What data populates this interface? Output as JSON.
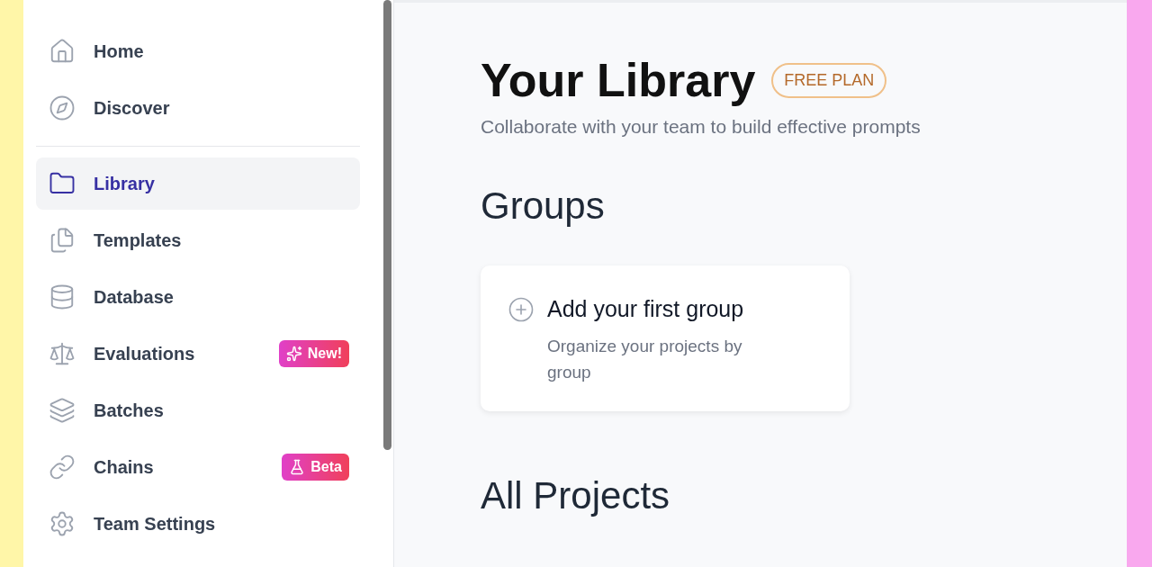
{
  "sidebar": {
    "sections": [
      [
        {
          "label": "Home",
          "selected": false
        },
        {
          "label": "Discover",
          "selected": false
        }
      ],
      [
        {
          "label": "Library",
          "selected": true
        },
        {
          "label": "Templates",
          "selected": false
        },
        {
          "label": "Database",
          "selected": false
        },
        {
          "label": "Evaluations",
          "selected": false,
          "badge": {
            "kind": "new",
            "text": "New!"
          }
        },
        {
          "label": "Batches",
          "selected": false
        },
        {
          "label": "Chains",
          "selected": false,
          "badge": {
            "kind": "beta",
            "text": "Beta"
          }
        },
        {
          "label": "Team Settings",
          "selected": false
        }
      ]
    ]
  },
  "header": {
    "title": "Your Library",
    "plan_badge": "FREE PLAN",
    "subtitle": "Collaborate with your team to build effective prompts"
  },
  "groups": {
    "heading": "Groups",
    "empty_card": {
      "title": "Add your first group",
      "description": "Organize your projects by group"
    }
  },
  "projects": {
    "heading": "All Projects"
  }
}
